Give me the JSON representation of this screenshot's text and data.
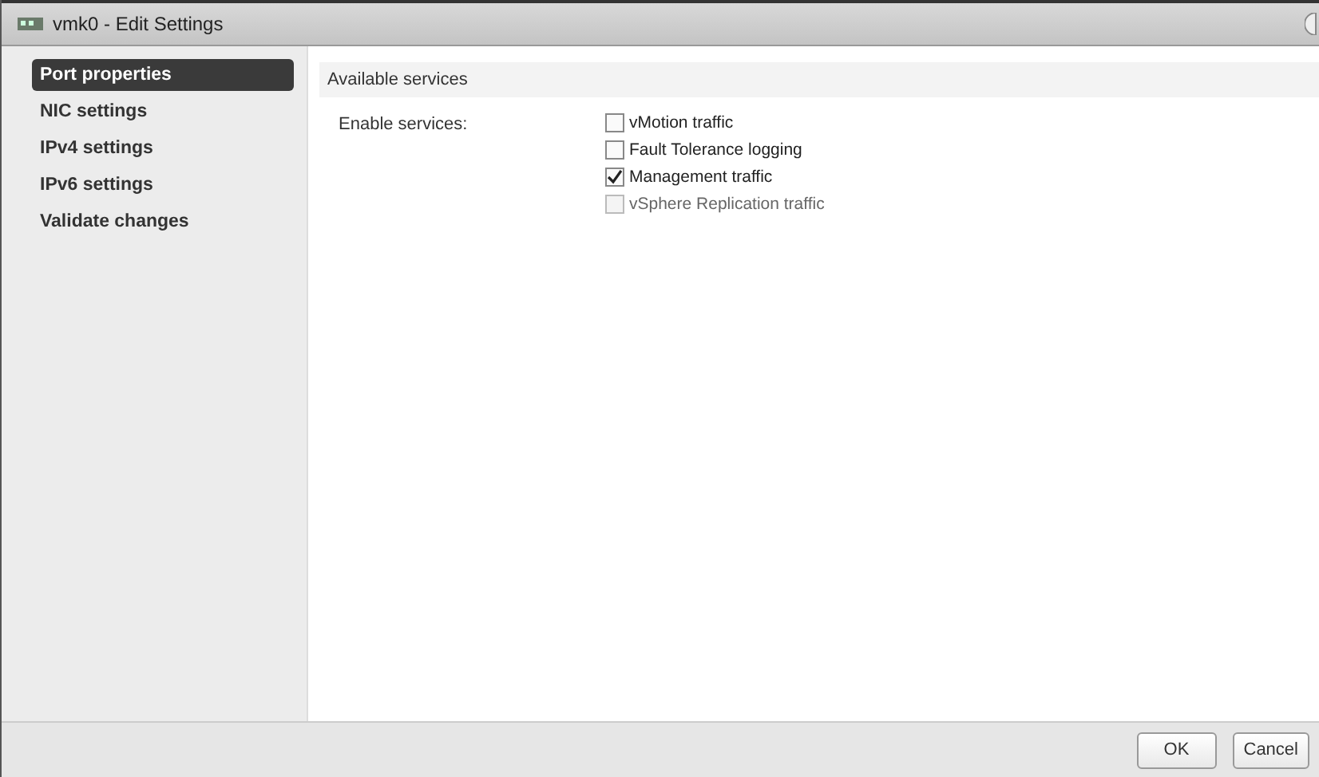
{
  "window": {
    "title": "vmk0 - Edit Settings"
  },
  "sidebar": {
    "items": [
      {
        "label": "Port properties",
        "selected": true
      },
      {
        "label": "NIC settings",
        "selected": false
      },
      {
        "label": "IPv4 settings",
        "selected": false
      },
      {
        "label": "IPv6 settings",
        "selected": false
      },
      {
        "label": "Validate changes",
        "selected": false
      }
    ]
  },
  "section": {
    "title": "Available services",
    "field_label": "Enable services:",
    "services": [
      {
        "label": "vMotion traffic",
        "checked": false,
        "disabled": false
      },
      {
        "label": "Fault Tolerance logging",
        "checked": false,
        "disabled": false
      },
      {
        "label": "Management traffic",
        "checked": true,
        "disabled": false
      },
      {
        "label": "vSphere Replication traffic",
        "checked": false,
        "disabled": true
      }
    ]
  },
  "buttons": [
    "OK",
    "Cancel"
  ]
}
